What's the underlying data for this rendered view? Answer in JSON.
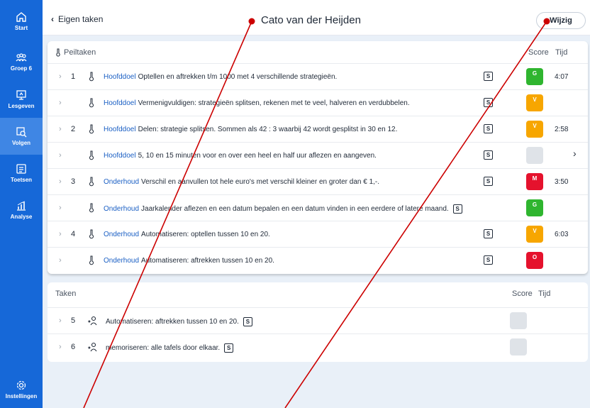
{
  "sidebar": {
    "items": [
      {
        "label": "Start",
        "icon": "home-icon"
      },
      {
        "label": "Groep 6",
        "icon": "group-icon"
      },
      {
        "label": "Lesgeven",
        "icon": "teach-icon"
      },
      {
        "label": "Volgen",
        "icon": "follow-icon"
      },
      {
        "label": "Toetsen",
        "icon": "tests-icon"
      },
      {
        "label": "Analyse",
        "icon": "chart-icon"
      },
      {
        "label": "Instellingen",
        "icon": "settings-icon"
      }
    ],
    "active": "Volgen"
  },
  "header": {
    "back_label": "Eigen taken",
    "title": "Cato van der Heijden",
    "edit_label": "Wijzig"
  },
  "peiltaken": {
    "title": "Peiltaken",
    "score_label": "Score",
    "tijd_label": "Tijd",
    "rows": [
      {
        "num": "1",
        "tag": "Hoofddoel",
        "text": "Optellen en aftrekken t/m 1000 met 4 verschillende strategieën.",
        "s": "S",
        "score": "G",
        "color": "#2fb52f",
        "tijd": "4:07"
      },
      {
        "num": "",
        "tag": "Hoofddoel",
        "text": "Vermenigvuldigen: strategieën splitsen, rekenen met te veel, halveren en verdubbelen.",
        "s": "S",
        "score": "V",
        "color": "#f7a600",
        "tijd": ""
      },
      {
        "num": "2",
        "tag": "Hoofddoel",
        "text": "Delen: strategie splitsen. Sommen als 42 : 3 waarbij 42 wordt gesplitst in 30 en 12.",
        "s": "S",
        "score": "V",
        "color": "#f7a600",
        "tijd": "2:58"
      },
      {
        "num": "",
        "tag": "Hoofddoel",
        "text": "5, 10 en 15 minuten voor en over een heel en half uur aflezen en aangeven.",
        "s": "S",
        "score": "",
        "color": "#dfe3e8",
        "tijd": ""
      },
      {
        "num": "3",
        "tag": "Onderhoud",
        "text": "Verschil en aanvullen tot hele euro's met verschil kleiner en groter dan € 1,-.",
        "s": "S",
        "score": "M",
        "color": "#e5122d",
        "tijd": "3:50"
      },
      {
        "num": "",
        "tag": "Onderhoud",
        "text": "Jaarkalender aflezen en een datum bepalen en een datum vinden in een eerdere of latere maand.",
        "s": "S",
        "score": "G",
        "color": "#2fb52f",
        "tijd": ""
      },
      {
        "num": "4",
        "tag": "Onderhoud",
        "text": "Automatiseren: optellen tussen 10 en 20.",
        "s": "S",
        "score": "V",
        "color": "#f7a600",
        "tijd": "6:03"
      },
      {
        "num": "",
        "tag": "Onderhoud",
        "text": "Automatiseren: aftrekken tussen 10 en 20.",
        "s": "S",
        "score": "O",
        "color": "#e5122d",
        "tijd": ""
      }
    ]
  },
  "taken": {
    "title": "Taken",
    "score_label": "Score",
    "tijd_label": "Tijd",
    "rows": [
      {
        "num": "5",
        "text": "Automatiseren: aftrekken tussen 10 en 20.",
        "s": "S",
        "color": "#dfe3e8"
      },
      {
        "num": "6",
        "text": "memoriseren: alle tafels door elkaar.",
        "s": "S",
        "color": "#dfe3e8"
      }
    ]
  },
  "annotation": {
    "color": "#cc0000"
  }
}
